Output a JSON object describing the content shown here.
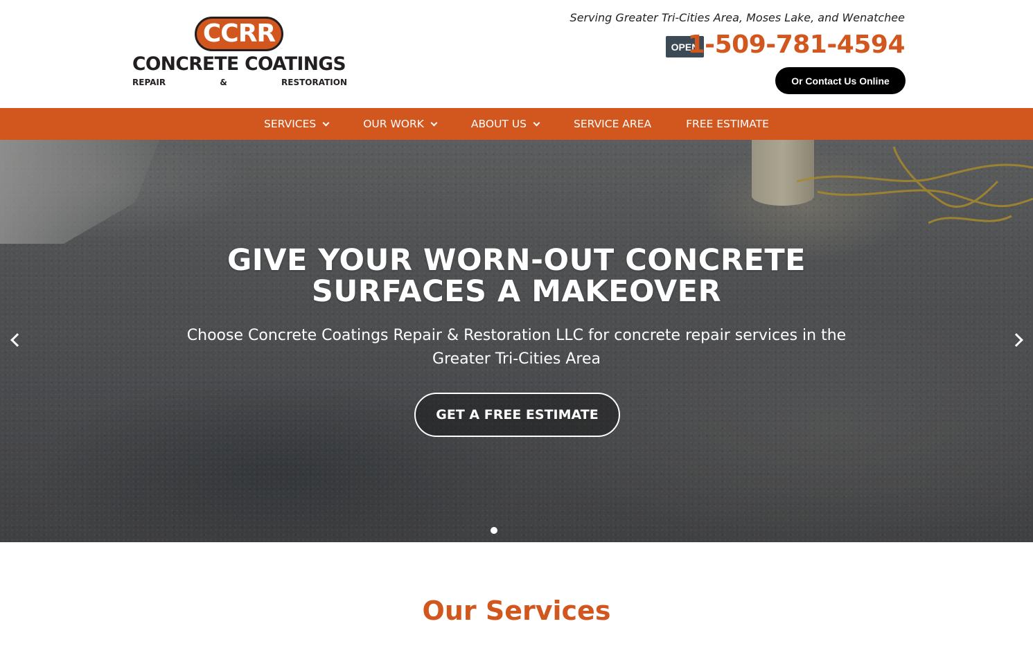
{
  "header": {
    "logo": {
      "badge_text": "CCRR",
      "title": "CONCRETE COATINGS",
      "subtitle_words": [
        "REPAIR",
        "&",
        "RESTORATION"
      ]
    },
    "serving": "Serving Greater Tri-Cities Area, Moses Lake, and Wenatchee",
    "open_badge": "OPEN",
    "phone": "1-509-781-4594",
    "contact_button": "Or Contact Us Online"
  },
  "nav": {
    "items": [
      {
        "label": "SERVICES",
        "dropdown": true
      },
      {
        "label": "OUR WORK",
        "dropdown": true
      },
      {
        "label": "ABOUT US",
        "dropdown": true
      },
      {
        "label": "SERVICE AREA",
        "dropdown": false
      },
      {
        "label": "FREE ESTIMATE",
        "dropdown": false
      }
    ]
  },
  "hero": {
    "title_line1": "GIVE YOUR WORN-OUT CONCRETE",
    "title_line2": "SURFACES A MAKEOVER",
    "subtitle": "Choose Concrete Coatings Repair & Restoration LLC for concrete repair services in the Greater Tri-Cities Area",
    "cta": "GET A FREE ESTIMATE",
    "slide_count": 1,
    "active_slide": 1
  },
  "services": {
    "heading": "Our Services"
  },
  "colors": {
    "brand_orange": "#d2571f",
    "dark": "#231f20",
    "open_badge_bg": "#3b4a54"
  }
}
